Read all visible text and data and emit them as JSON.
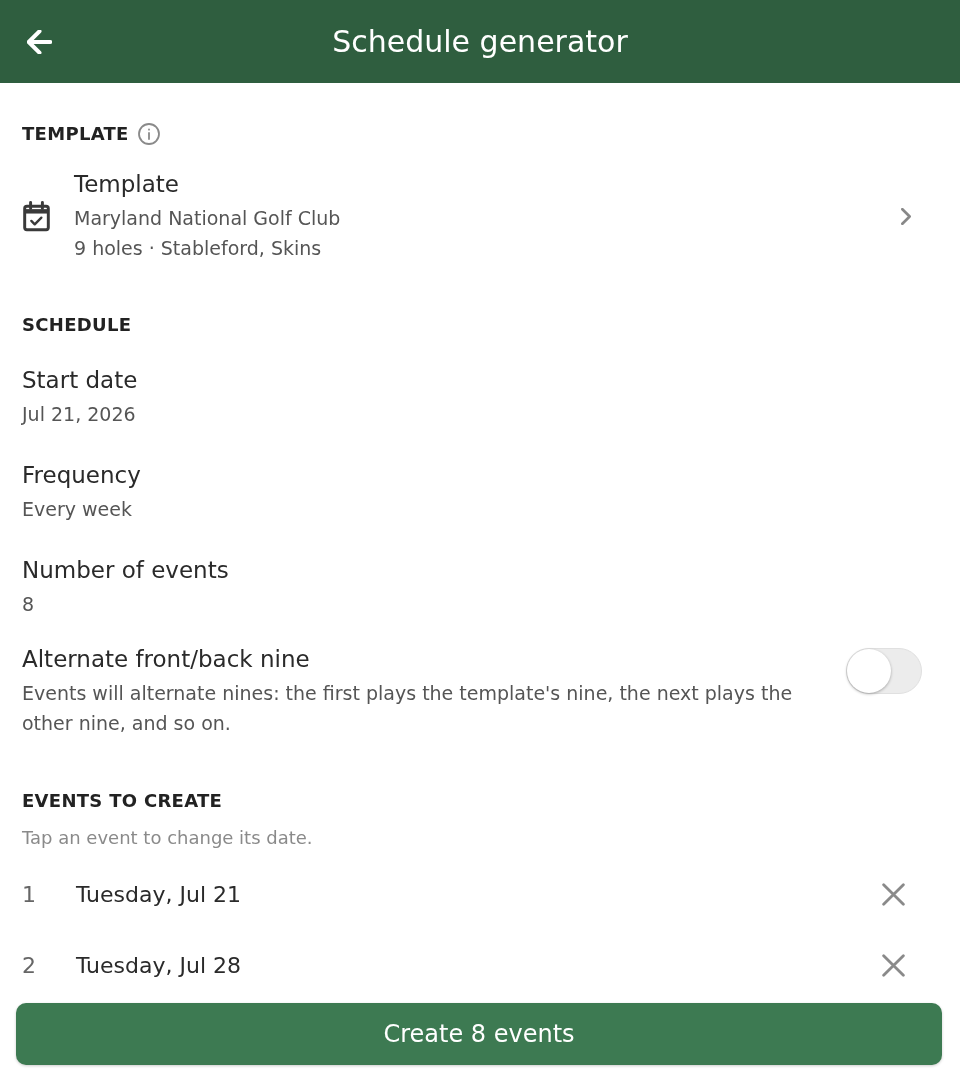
{
  "header": {
    "title": "Schedule generator"
  },
  "template_section": {
    "heading": "TEMPLATE",
    "item": {
      "title": "Template",
      "subtitle": "Maryland National Golf Club",
      "detail": "9 holes · Stableford, Skins"
    }
  },
  "schedule_section": {
    "heading": "SCHEDULE",
    "fields": [
      {
        "label": "Start date",
        "value": "Jul 21, 2026"
      },
      {
        "label": "Frequency",
        "value": "Every week"
      },
      {
        "label": "Number of events",
        "value": "8"
      }
    ],
    "toggle": {
      "label": "Alternate front/back nine",
      "description": "Events will alternate nines: the first plays the template's nine, the next plays the other nine, and so on.",
      "on": false
    }
  },
  "events_section": {
    "heading": "EVENTS TO CREATE",
    "hint": "Tap an event to change its date.",
    "events": [
      {
        "number": "1",
        "date": "Tuesday, Jul 21"
      },
      {
        "number": "2",
        "date": "Tuesday, Jul 28"
      }
    ]
  },
  "primary_button": {
    "label": "Create 8 events"
  }
}
